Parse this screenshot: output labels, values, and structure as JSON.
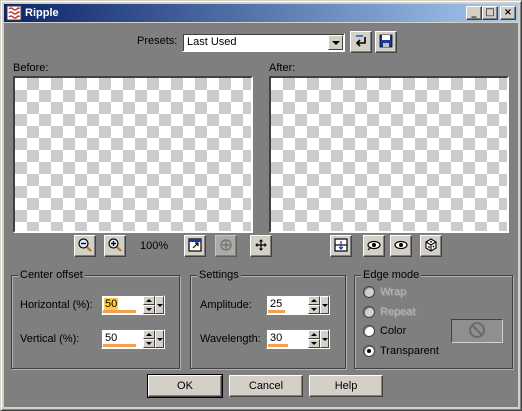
{
  "window": {
    "title": "Ripple",
    "titlebar_buttons": [
      "minimize",
      "maximize",
      "close"
    ]
  },
  "presets": {
    "label": "Presets:",
    "selected": "Last Used"
  },
  "preview": {
    "before_label": "Before:",
    "after_label": "After:",
    "zoom": "100%"
  },
  "center_offset": {
    "title": "Center offset",
    "horizontal_label": "Horizontal (%):",
    "horizontal_value": "50",
    "vertical_label": "Vertical (%):",
    "vertical_value": "50"
  },
  "settings": {
    "title": "Settings",
    "amplitude_label": "Amplitude:",
    "amplitude_value": "25",
    "wavelength_label": "Wavelength:",
    "wavelength_value": "30"
  },
  "edge_mode": {
    "title": "Edge mode",
    "options": [
      {
        "label": "Wrap",
        "enabled": false,
        "checked": false
      },
      {
        "label": "Repeat",
        "enabled": false,
        "checked": false
      },
      {
        "label": "Color",
        "enabled": true,
        "checked": false
      },
      {
        "label": "Transparent",
        "enabled": true,
        "checked": true
      }
    ]
  },
  "buttons": {
    "ok": "OK",
    "cancel": "Cancel",
    "help": "Help"
  },
  "colors": {
    "dialog_bg": "#7f7f7f",
    "titlebar_start": "#0a246a",
    "titlebar_end": "#a6caf0",
    "selected_value_highlight": "#ffcc44",
    "spin_bar": "#f0a050"
  },
  "icons": [
    "ripple-app-icon",
    "reset-preset-icon",
    "save-preset-icon",
    "zoom-out-icon",
    "zoom-in-icon",
    "fit-window-icon",
    "navigate-icon",
    "move-preview-icon",
    "toggle-split-icon",
    "proof-icon",
    "auto-proof-icon",
    "randomize-icon",
    "no-color-icon"
  ]
}
